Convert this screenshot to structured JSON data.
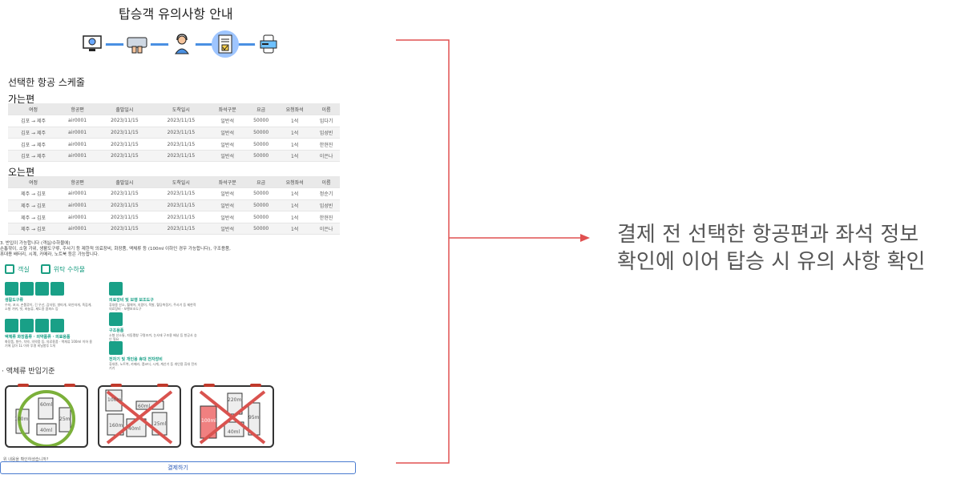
{
  "header": {
    "title": "탑승객 유의사항 안내",
    "steps": [
      {
        "icon": "schedule-monitor-icon"
      },
      {
        "icon": "keyboard-input-icon"
      },
      {
        "icon": "agent-headset-icon"
      },
      {
        "icon": "checklist-document-icon"
      },
      {
        "icon": "mobile-payment-icon"
      }
    ]
  },
  "schedule": {
    "title": "선택한 항공 스케줄",
    "columns": [
      "여정",
      "항공편",
      "출발일시",
      "도착일시",
      "좌석구분",
      "요금",
      "요청좌석",
      "이름"
    ],
    "outbound": {
      "label": "가는편",
      "rows": [
        [
          "김포 → 제주",
          "air0001",
          "2023/11/15",
          "2023/11/15",
          "일반석",
          "50000",
          "1석",
          "임다기"
        ],
        [
          "김포 → 제주",
          "air0001",
          "2023/11/15",
          "2023/11/15",
          "일반석",
          "50000",
          "1석",
          "임성빈"
        ],
        [
          "김포 → 제주",
          "air0001",
          "2023/11/15",
          "2023/11/15",
          "일반석",
          "50000",
          "1석",
          "한현진"
        ],
        [
          "김포 → 제주",
          "air0001",
          "2023/11/15",
          "2023/11/15",
          "일반석",
          "50000",
          "1석",
          "이은나"
        ]
      ]
    },
    "return": {
      "label": "오는편",
      "rows": [
        [
          "제주 → 김포",
          "air0001",
          "2023/11/15",
          "2023/11/15",
          "일반석",
          "50000",
          "1석",
          "정순기"
        ],
        [
          "제주 → 김포",
          "air0001",
          "2023/11/15",
          "2023/11/15",
          "일반석",
          "50000",
          "1석",
          "임성빈"
        ],
        [
          "제주 → 김포",
          "air0001",
          "2023/11/15",
          "2023/11/15",
          "일반석",
          "50000",
          "1석",
          "한현진"
        ],
        [
          "제주 → 김포",
          "air0001",
          "2023/11/15",
          "2023/11/15",
          "일반석",
          "50000",
          "1석",
          "이은나"
        ]
      ]
    }
  },
  "notice": {
    "line1": "3. 반입이 가능합니다 (객실/수하물에)",
    "line2": "손톱깎이, 소형 가위, 생활도구류, 주사기 등 제한적 의료장비, 화장품, 액체류 등 (100ml 이하인 경우 가능합니다), 구조용품,",
    "line3": "휴대용 배터리, 시계, 카메라, 노트북 등은 가능합니다."
  },
  "legend": {
    "cabin": "객실",
    "checked": "위탁 수하물"
  },
  "groups": {
    "daily_tools": {
      "title": "생활도구류",
      "desc": "수저, 포크, 손톱깎이, 긴 우산, 감자칼, 병따개, 와인따개, 족집게, 소형 가위, 빗, 바늘류, 제도용 콤파스 등"
    },
    "cosmetics": {
      "title": "액체류 화장품류 · 의약품류 · 의료용품",
      "desc": "화장품, 향수, 치약, 의약품 등, 의료용품 · 액체류 100ml 이하 용기에 담아 1L 이하 투명 비닐봉투 1개"
    },
    "medical": {
      "title": "의료장비 및 보행 보조도구",
      "desc": "휴대용 산소, 휠체어, 지팡이, 목발, 혈당측정기, 주사기 등 제한적 의료장비 · 보행보조도구"
    },
    "rescue": {
      "title": "구조용품",
      "desc": "소형 산소통, 자동팽창 구명조끼, 눈사태 구조용 배낭 등 항공사 승인 필요"
    },
    "electronics": {
      "title": "전자기 및 개인용 휴대 전자장비",
      "desc": "휴대폰, 노트북, 카메라, 캠코더, 시계, 계산기 등 개인용 휴대 전자기기"
    }
  },
  "liquids": {
    "title": "· 액체류 반입기준",
    "bags": [
      {
        "status": "allowed",
        "labels": [
          "100ml",
          "60ml",
          "25ml",
          "40ml"
        ]
      },
      {
        "status": "denied",
        "labels": [
          "100ml",
          "40ml",
          "60ml",
          "25ml",
          "160ml"
        ]
      },
      {
        "status": "denied",
        "labels": [
          "100ml",
          "220ml",
          "95ml",
          "40ml"
        ]
      }
    ]
  },
  "agree_text": "위 내용을 확인하셨습니까?",
  "pay_button": "결제하기",
  "caption": {
    "line1": "결제 전 선택한 항공편과 좌석 정보",
    "line2": "확인에 이어 탑승 시 유의 사항 확인"
  },
  "colors": {
    "accent_green": "#19a087",
    "annotation_red": "#e05050",
    "step_blue": "#4a90e2"
  }
}
